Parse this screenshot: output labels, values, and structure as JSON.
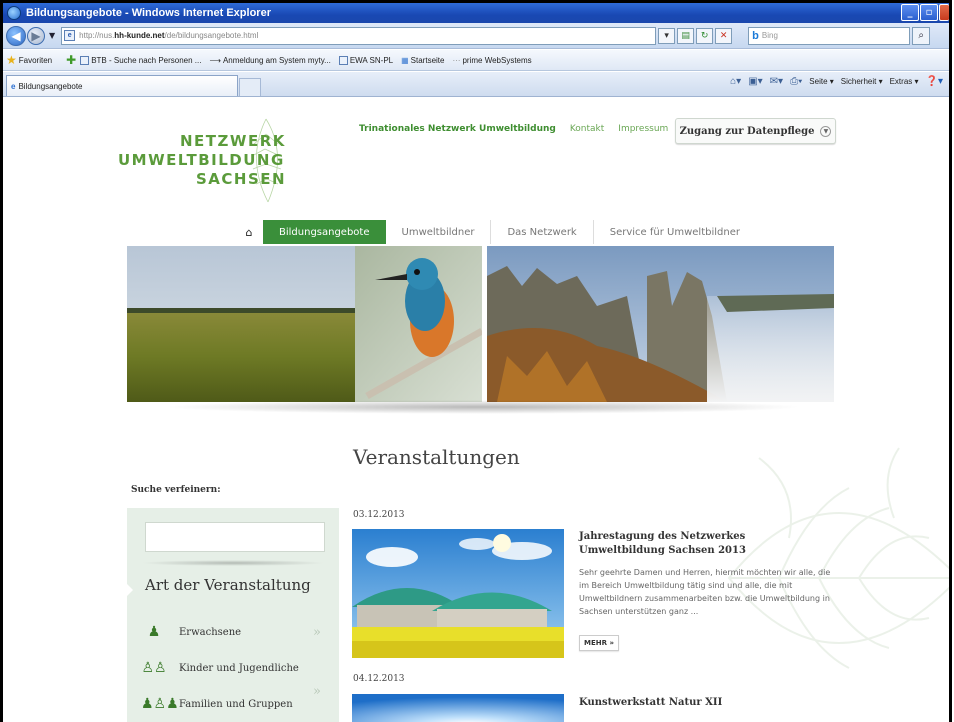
{
  "window": {
    "title": "Bildungsangebote - Windows Internet Explorer"
  },
  "address_bar": {
    "url_prefix": "http://nus.",
    "url_domain": "hh-kunde.net",
    "url_path": "/de/bildungsangebote.html",
    "search_placeholder": "Bing"
  },
  "favorites_bar": {
    "favorites_label": "Favoriten",
    "items": [
      "BTB - Suche nach Personen ...",
      "Anmeldung am System myty...",
      "EWA SN-PL",
      "Startseite",
      "prime WebSystems"
    ]
  },
  "tabs": [
    {
      "label": "Bildungsangebote"
    }
  ],
  "command_bar": {
    "items": [
      "Seite",
      "Sicherheit",
      "Extras"
    ]
  },
  "site": {
    "logo": {
      "line1": "NETZWERK",
      "line2": "UMWELTBILDUNG",
      "line3": "SACHSEN"
    },
    "top_links": [
      "Trinationales Netzwerk Umweltbildung",
      "Kontakt",
      "Impressum"
    ],
    "login_button": "Zugang zur Datenpflege",
    "main_nav": [
      "Bildungsangebote",
      "Umweltbildner",
      "Das Netzwerk",
      "Service für Umweltbildner"
    ],
    "active_nav_index": 0,
    "section_heading": "Veranstaltungen",
    "search_refine_label": "Suche verfeinern:",
    "filter": {
      "heading": "Art der Veranstaltung",
      "categories": [
        "Erwachsene",
        "Kinder und Jugendliche",
        "Familien und Gruppen"
      ]
    },
    "events": [
      {
        "date": "03.12.2013",
        "title": "Jahrestagung des Netzwerkes Umweltbildung Sachsen 2013",
        "text": "Sehr geehrte Damen und Herren, hiermit möchten wir alle, die im Bereich Umweltbildung tätig sind und alle, die mit Umweltbildnern zusammenarbeiten bzw. die Umweltbildung in Sachsen unterstützen ganz ...",
        "more_label": "MEHR »"
      },
      {
        "date": "04.12.2013",
        "title": "Kunstwerkstatt Natur XII",
        "text": "",
        "more_label": ""
      }
    ]
  },
  "colors": {
    "brand_green": "#3a8f3a",
    "logo_green": "#5b9b3b",
    "sidebar_bg": "#e6efe7",
    "titlebar_blue": "#1948b3"
  }
}
